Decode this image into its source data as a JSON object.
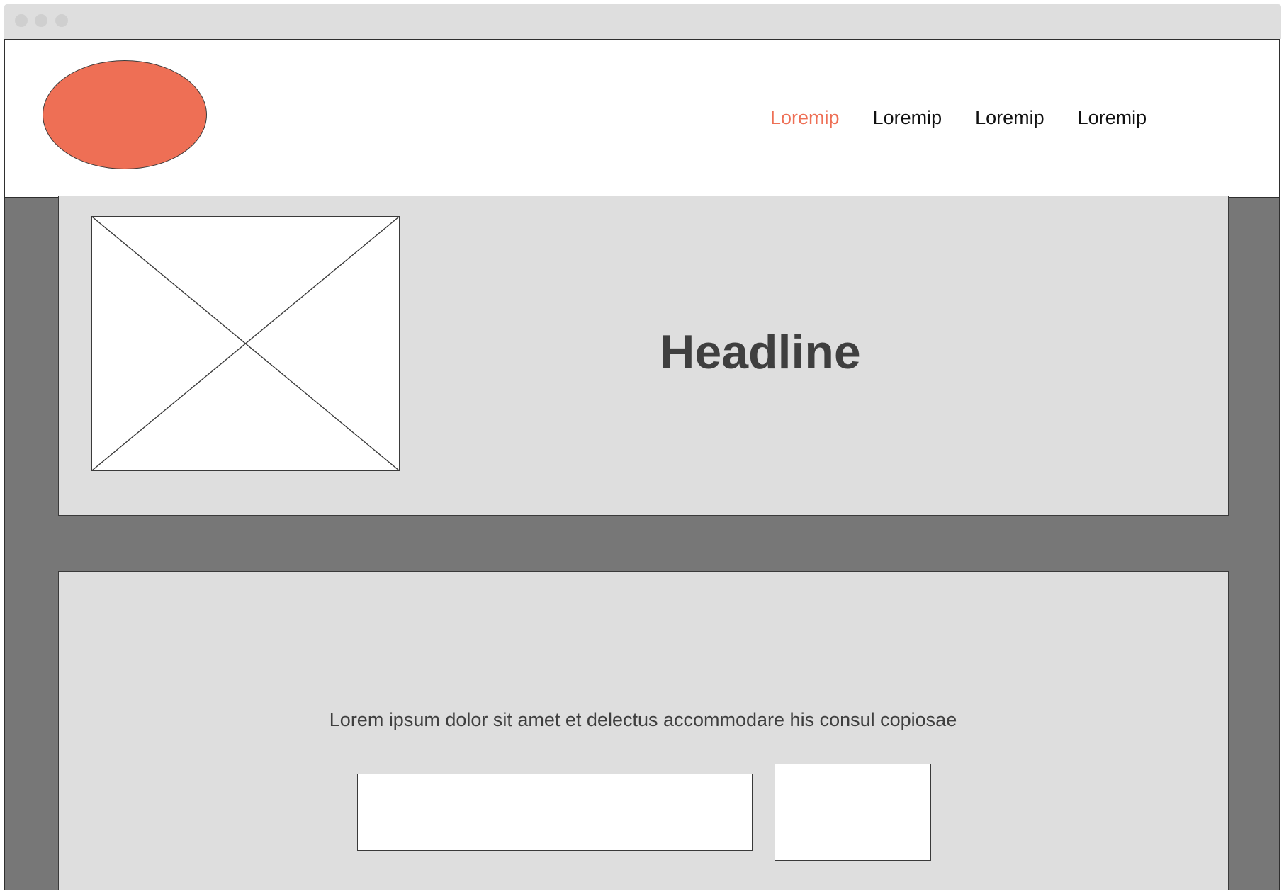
{
  "header": {
    "nav": [
      {
        "label": "Loremip",
        "active": true
      },
      {
        "label": "Loremip",
        "active": false
      },
      {
        "label": "Loremip",
        "active": false
      },
      {
        "label": "Loremip",
        "active": false
      }
    ]
  },
  "hero": {
    "headline": "Headline",
    "image_icon": "image-placeholder-icon"
  },
  "signup": {
    "text": "Lorem ipsum dolor sit amet et delectus accommodare his consul copiosae",
    "input_value": "",
    "button_label": ""
  },
  "colors": {
    "accent": "#ee6f55",
    "panel": "#dedede",
    "page_background": "#777777",
    "text": "#3f3f3f"
  }
}
